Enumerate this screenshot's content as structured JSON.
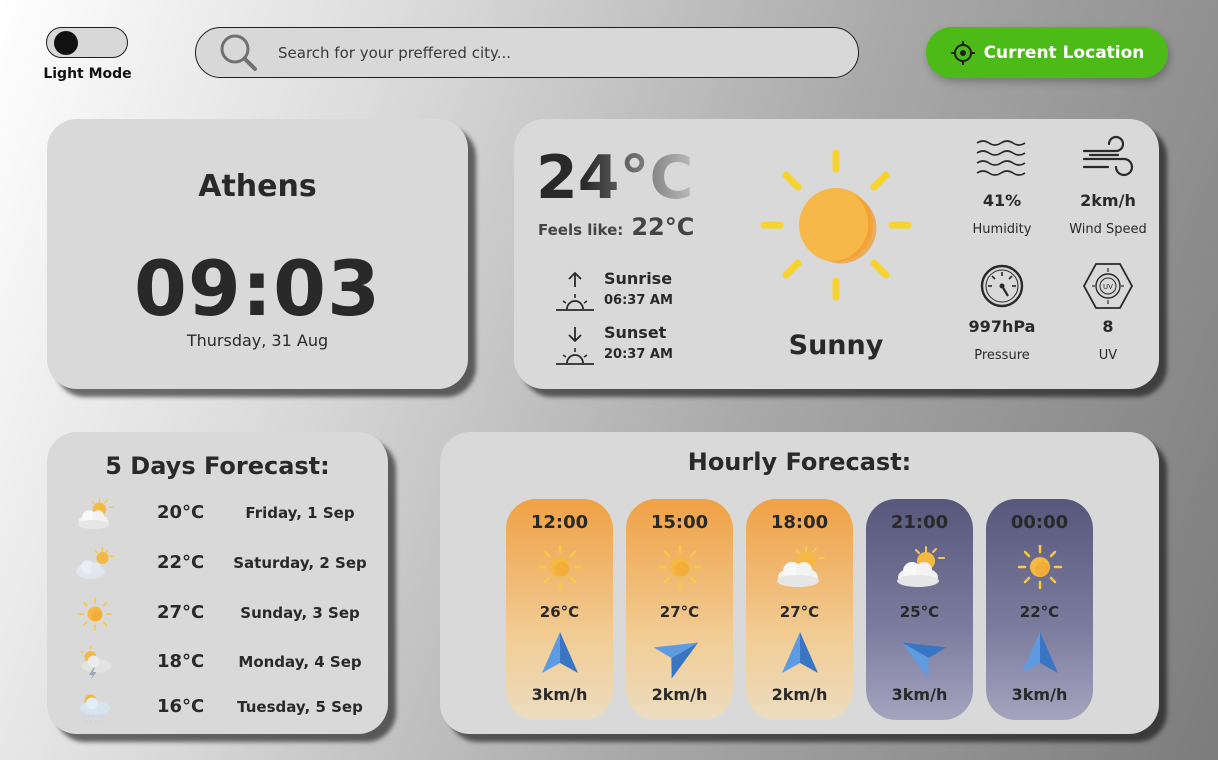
{
  "header": {
    "mode_label": "Light Mode",
    "search_placeholder": "Search for your preffered city...",
    "location_button": "Current Location",
    "accent_color": "#4cbb17"
  },
  "city": {
    "name": "Athens",
    "time": "09:03",
    "date": "Thursday, 31 Aug"
  },
  "current": {
    "temperature": "24°C",
    "feels_like_label": "Feels like:",
    "feels_like": "22°C",
    "sunrise_label": "Sunrise",
    "sunrise_time": "06:37 AM",
    "sunset_label": "Sunset",
    "sunset_time": "20:37 AM",
    "condition": "Sunny",
    "condition_icon": "sun-icon",
    "humidity": "41%",
    "humidity_label": "Humidity",
    "wind_speed": "2km/h",
    "wind_speed_label": "Wind Speed",
    "pressure": "997hPa",
    "pressure_label": "Pressure",
    "uv": "8",
    "uv_label": "UV"
  },
  "forecast": {
    "title": "5 Days Forecast:",
    "days": [
      {
        "icon": "partly-cloudy-icon",
        "temp": "20°C",
        "date": "Friday, 1 Sep"
      },
      {
        "icon": "sun-behind-cloud-icon",
        "temp": "22°C",
        "date": "Saturday, 2 Sep"
      },
      {
        "icon": "sun-icon",
        "temp": "27°C",
        "date": "Sunday, 3 Sep"
      },
      {
        "icon": "thunderstorm-icon",
        "temp": "18°C",
        "date": "Monday, 4 Sep"
      },
      {
        "icon": "rain-icon",
        "temp": "16°C",
        "date": "Tuesday, 5 Sep"
      }
    ]
  },
  "hourly": {
    "title": "Hourly Forecast:",
    "items": [
      {
        "time": "12:00",
        "icon": "sun-icon",
        "temp": "26°C",
        "wind": "3km/h",
        "theme": "day",
        "wind_direction_icon": "navigation-arrow-icon"
      },
      {
        "time": "15:00",
        "icon": "sun-icon",
        "temp": "27°C",
        "wind": "2km/h",
        "theme": "day",
        "wind_direction_icon": "navigation-arrow-icon"
      },
      {
        "time": "18:00",
        "icon": "partly-cloudy-icon",
        "temp": "27°C",
        "wind": "2km/h",
        "theme": "day",
        "wind_direction_icon": "navigation-arrow-icon"
      },
      {
        "time": "21:00",
        "icon": "partly-cloudy-icon",
        "temp": "25°C",
        "wind": "3km/h",
        "theme": "night",
        "wind_direction_icon": "navigation-arrow-icon"
      },
      {
        "time": "00:00",
        "icon": "sun-icon",
        "temp": "22°C",
        "wind": "3km/h",
        "theme": "night",
        "wind_direction_icon": "navigation-arrow-icon"
      }
    ]
  }
}
